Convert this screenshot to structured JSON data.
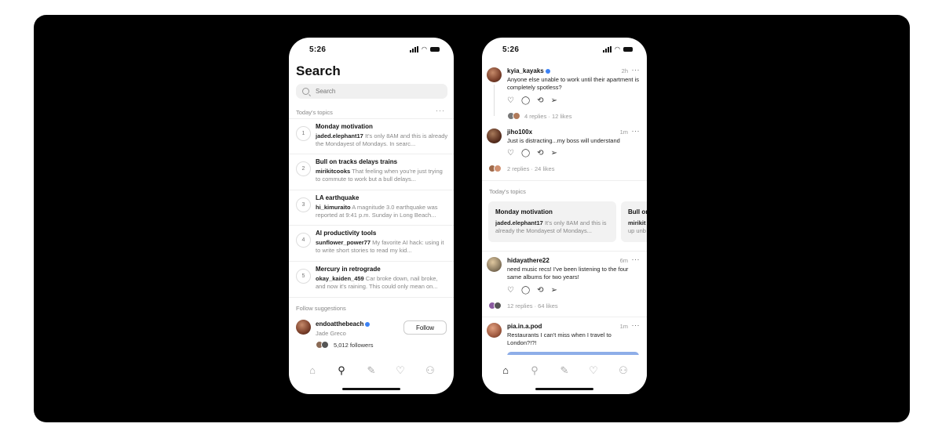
{
  "search_screen": {
    "status_time": "5:26",
    "title": "Search",
    "search_placeholder": "Search",
    "topics_label": "Today's topics",
    "more_glyph": "···",
    "topics": [
      {
        "num": "1",
        "title": "Monday motivation",
        "user": "jaded.elephant17",
        "text": " It's only 8AM and this is already the Mondayest of Mondays. In searc..."
      },
      {
        "num": "2",
        "title": "Bull on tracks delays trains",
        "user": "mirikitcooks",
        "text": " That feeling when you're just trying to commute to work but a bull delays..."
      },
      {
        "num": "3",
        "title": "LA earthquake",
        "user": "hi_kimuraito",
        "text": " A magnitude 3.0 earthquake was reported at 9:41 p.m. Sunday in Long Beach..."
      },
      {
        "num": "4",
        "title": "AI productivity tools",
        "user": "sunflower_power77",
        "text": " My favorite AI hack: using it to write short stories to read my kid..."
      },
      {
        "num": "5",
        "title": "Mercury in retrograde",
        "user": "okay_kaiden_459",
        "text": " Car broke down, nail broke, and now it's raining. This could only mean on..."
      }
    ],
    "follow_label": "Follow suggestions",
    "suggestion": {
      "username": "endoatthebeach",
      "name": "Jade Greco",
      "followers": "5,012 followers",
      "button": "Follow"
    }
  },
  "feed_screen": {
    "status_time": "5:26",
    "posts": [
      {
        "username": "kyia_kayaks",
        "time": "2h",
        "text": "Anyone else unable to work until their apartment is completely spotless?",
        "stats": "4 replies · 12 likes"
      },
      {
        "username": "jiho100x",
        "time": "1m",
        "text": "Just is distracting...my boss will understand",
        "stats": "2 replies · 24 likes"
      },
      {
        "username": "hidayathere22",
        "time": "6m",
        "text": "need music recs! I've been listening to the four same albums for two years!",
        "stats": "12 replies · 64 likes"
      },
      {
        "username": "pia.in.a.pod",
        "time": "1m",
        "text": "Restaurants I can't miss when I travel to London?!?!",
        "stats": ""
      }
    ],
    "topics_label": "Today's topics",
    "cards": [
      {
        "title": "Monday motivation",
        "user": "jaded.elephant17",
        "text": " It's only 8AM and this is already the Mondayest of Mondays..."
      },
      {
        "title": "Bull on",
        "user": "mirikit",
        "text": " up unb"
      }
    ],
    "more_glyph": "···"
  },
  "icons": {
    "home": "⌂",
    "search": "⚲",
    "compose": "✎",
    "heart": "♡",
    "profile": "⚇",
    "like": "♡",
    "comment": "◯",
    "repost": "⟲",
    "share": "➢"
  },
  "colors": {
    "verified": "#3b82f6",
    "image_accent": "#8eaee8"
  }
}
